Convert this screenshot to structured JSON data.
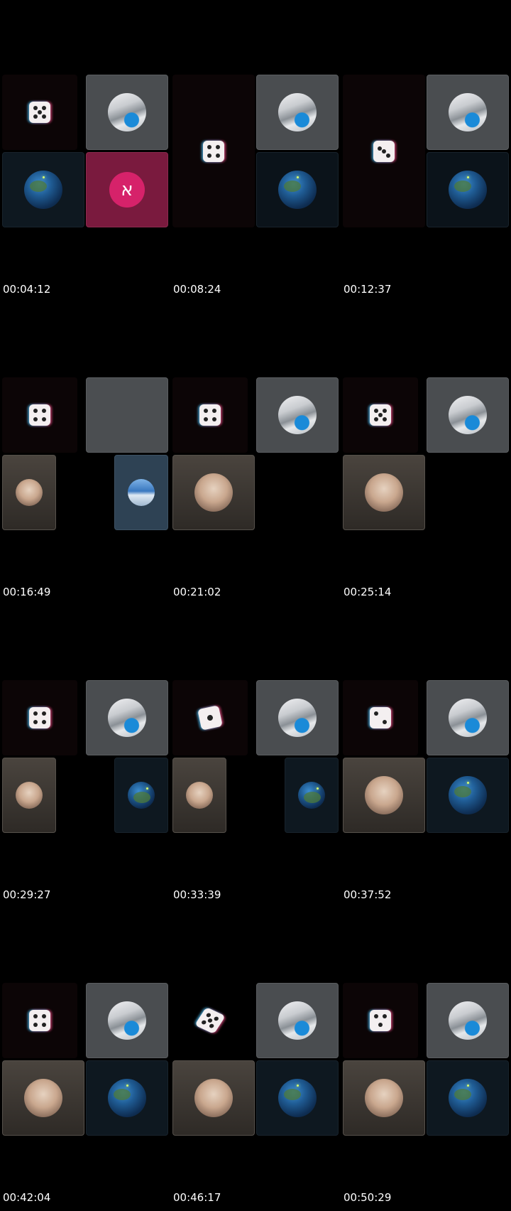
{
  "timestamps": [
    "00:04:12",
    "00:08:24",
    "00:12:37",
    "00:16:49",
    "00:21:02",
    "00:25:14",
    "00:29:27",
    "00:33:39",
    "00:37:52",
    "00:42:04",
    "00:46:17",
    "00:50:29"
  ],
  "avatar_letter": "א",
  "icons": {
    "dice": "dice-icon",
    "avatar": "letter-avatar"
  },
  "colors": {
    "background": "#000000",
    "avatar_pink": "#d6226a",
    "text": "#ffffff"
  }
}
